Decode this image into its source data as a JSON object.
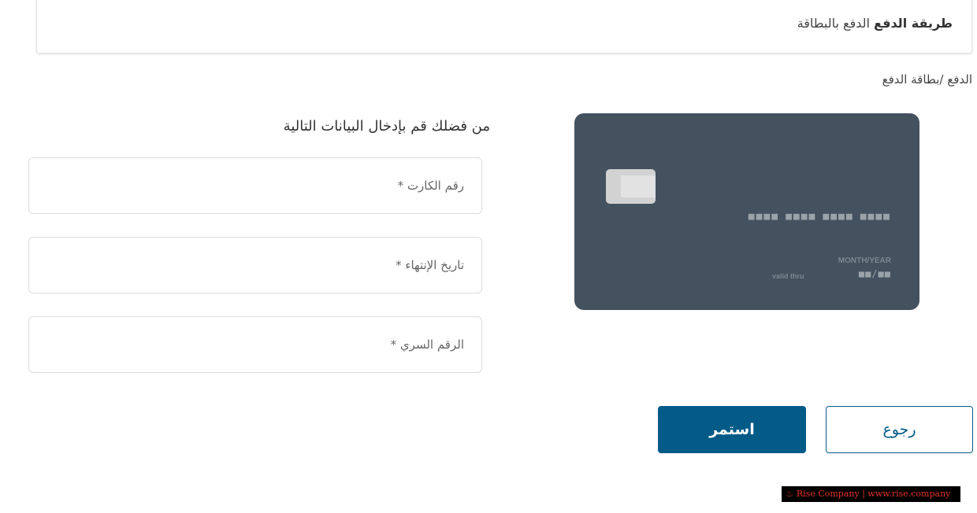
{
  "payment_method": {
    "label": "طريقة الدفع",
    "value": "الدفع بالبطاقة"
  },
  "breadcrumb": {
    "root": "الدفع",
    "separator": "/",
    "current": "بطاقة الدفع"
  },
  "form": {
    "title": "من فضلك قم بإدخال البيانات التالية",
    "card_number_placeholder": "رقم الكارت *",
    "expiry_placeholder": "تاريخ الإنتهاء *",
    "cvv_placeholder": "الرقم السري *"
  },
  "card_preview": {
    "number_groups": [
      "■■■■",
      "■■■■",
      "■■■■",
      "■■■■"
    ],
    "expiry_label": "MONTH/YEAR",
    "expiry_value": "■■/■■",
    "valid_label": "valid thru",
    "color": "#44525f"
  },
  "buttons": {
    "continue_label": "استمر",
    "back_label": "رجوع"
  },
  "watermark": {
    "text": "Rise Company | www.rise.company"
  },
  "colors": {
    "primary": "#045b88",
    "watermark_bg": "#000000",
    "watermark_text": "#e3332c"
  }
}
